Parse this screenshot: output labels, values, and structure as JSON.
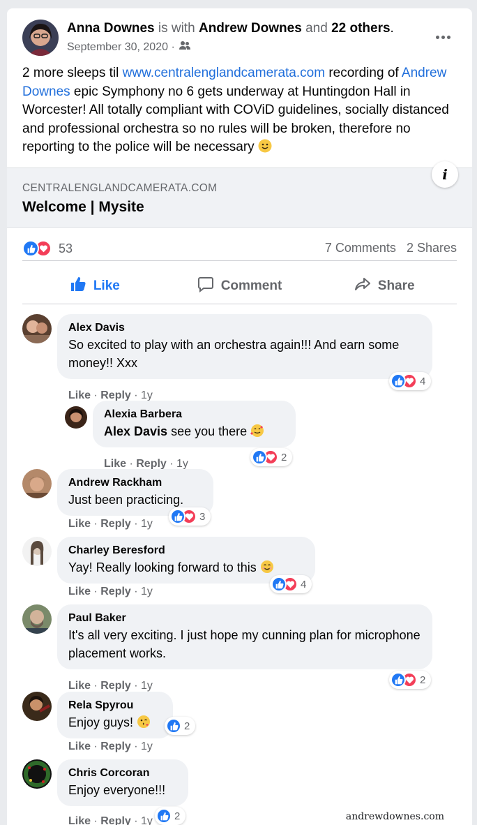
{
  "post": {
    "author": "Anna Downes",
    "with_text": "is with",
    "tagged": "Andrew Downes",
    "and_text": "and",
    "others": "22 others",
    "period": ".",
    "date": "September 30, 2020 ·",
    "audience_icon": "friends-icon",
    "text_1": "2 more sleeps til ",
    "link_url": "www.centralenglandcamerata.com",
    "text_2": " recording of ",
    "link_name": "Andrew Downes",
    "text_3": " epic Symphony no 6 gets underway at Huntingdon Hall in Worcester! All totally compliant with COViD guidelines, socially distanced and professional orchestra so no rules will be broken, therefore no reporting to the police will be necessary "
  },
  "preview": {
    "domain": "CENTRALENGLANDCAMERATA.COM",
    "title": "Welcome | Mysite",
    "info_label": "i"
  },
  "stats": {
    "reactions": "53",
    "comments": "7 Comments",
    "shares": "2 Shares"
  },
  "actions": {
    "like": "Like",
    "comment": "Comment",
    "share": "Share"
  },
  "comments": [
    {
      "name": "Alex Davis",
      "text": "So excited to play with an orchestra again!!! And earn some money!! Xxx",
      "like": "Like",
      "reply": "Reply",
      "time": "1y",
      "count": "4"
    },
    {
      "name": "Alexia Barbera",
      "mention": "Alex Davis",
      "text": " see you there ",
      "like": "Like",
      "reply": "Reply",
      "time": "1y",
      "count": "2"
    },
    {
      "name": "Andrew Rackham",
      "text": "Just been practicing.",
      "like": "Like",
      "reply": "Reply",
      "time": "1y",
      "count": "3"
    },
    {
      "name": "Charley Beresford",
      "text": "Yay! Really looking forward to this ",
      "like": "Like",
      "reply": "Reply",
      "time": "1y",
      "count": "4"
    },
    {
      "name": "Paul Baker",
      "text": "It's all very exciting. I just hope my cunning plan for microphone placement works.",
      "like": "Like",
      "reply": "Reply",
      "time": "1y",
      "count": "2"
    },
    {
      "name": "Rela Spyrou",
      "text": "Enjoy guys! ",
      "like": "Like",
      "reply": "Reply",
      "time": "1y",
      "count": "2"
    },
    {
      "name": "Chris Corcoran",
      "text": "Enjoy everyone!!!",
      "like": "Like",
      "reply": "Reply",
      "time": "1y",
      "count": "2"
    }
  ],
  "watermark": "andrewdownes.com",
  "colors": {
    "link": "#216fdb",
    "like_blue": "#2078f4",
    "love_red": "#f33e58",
    "muted": "#65676b",
    "bubble": "#f0f2f5"
  }
}
